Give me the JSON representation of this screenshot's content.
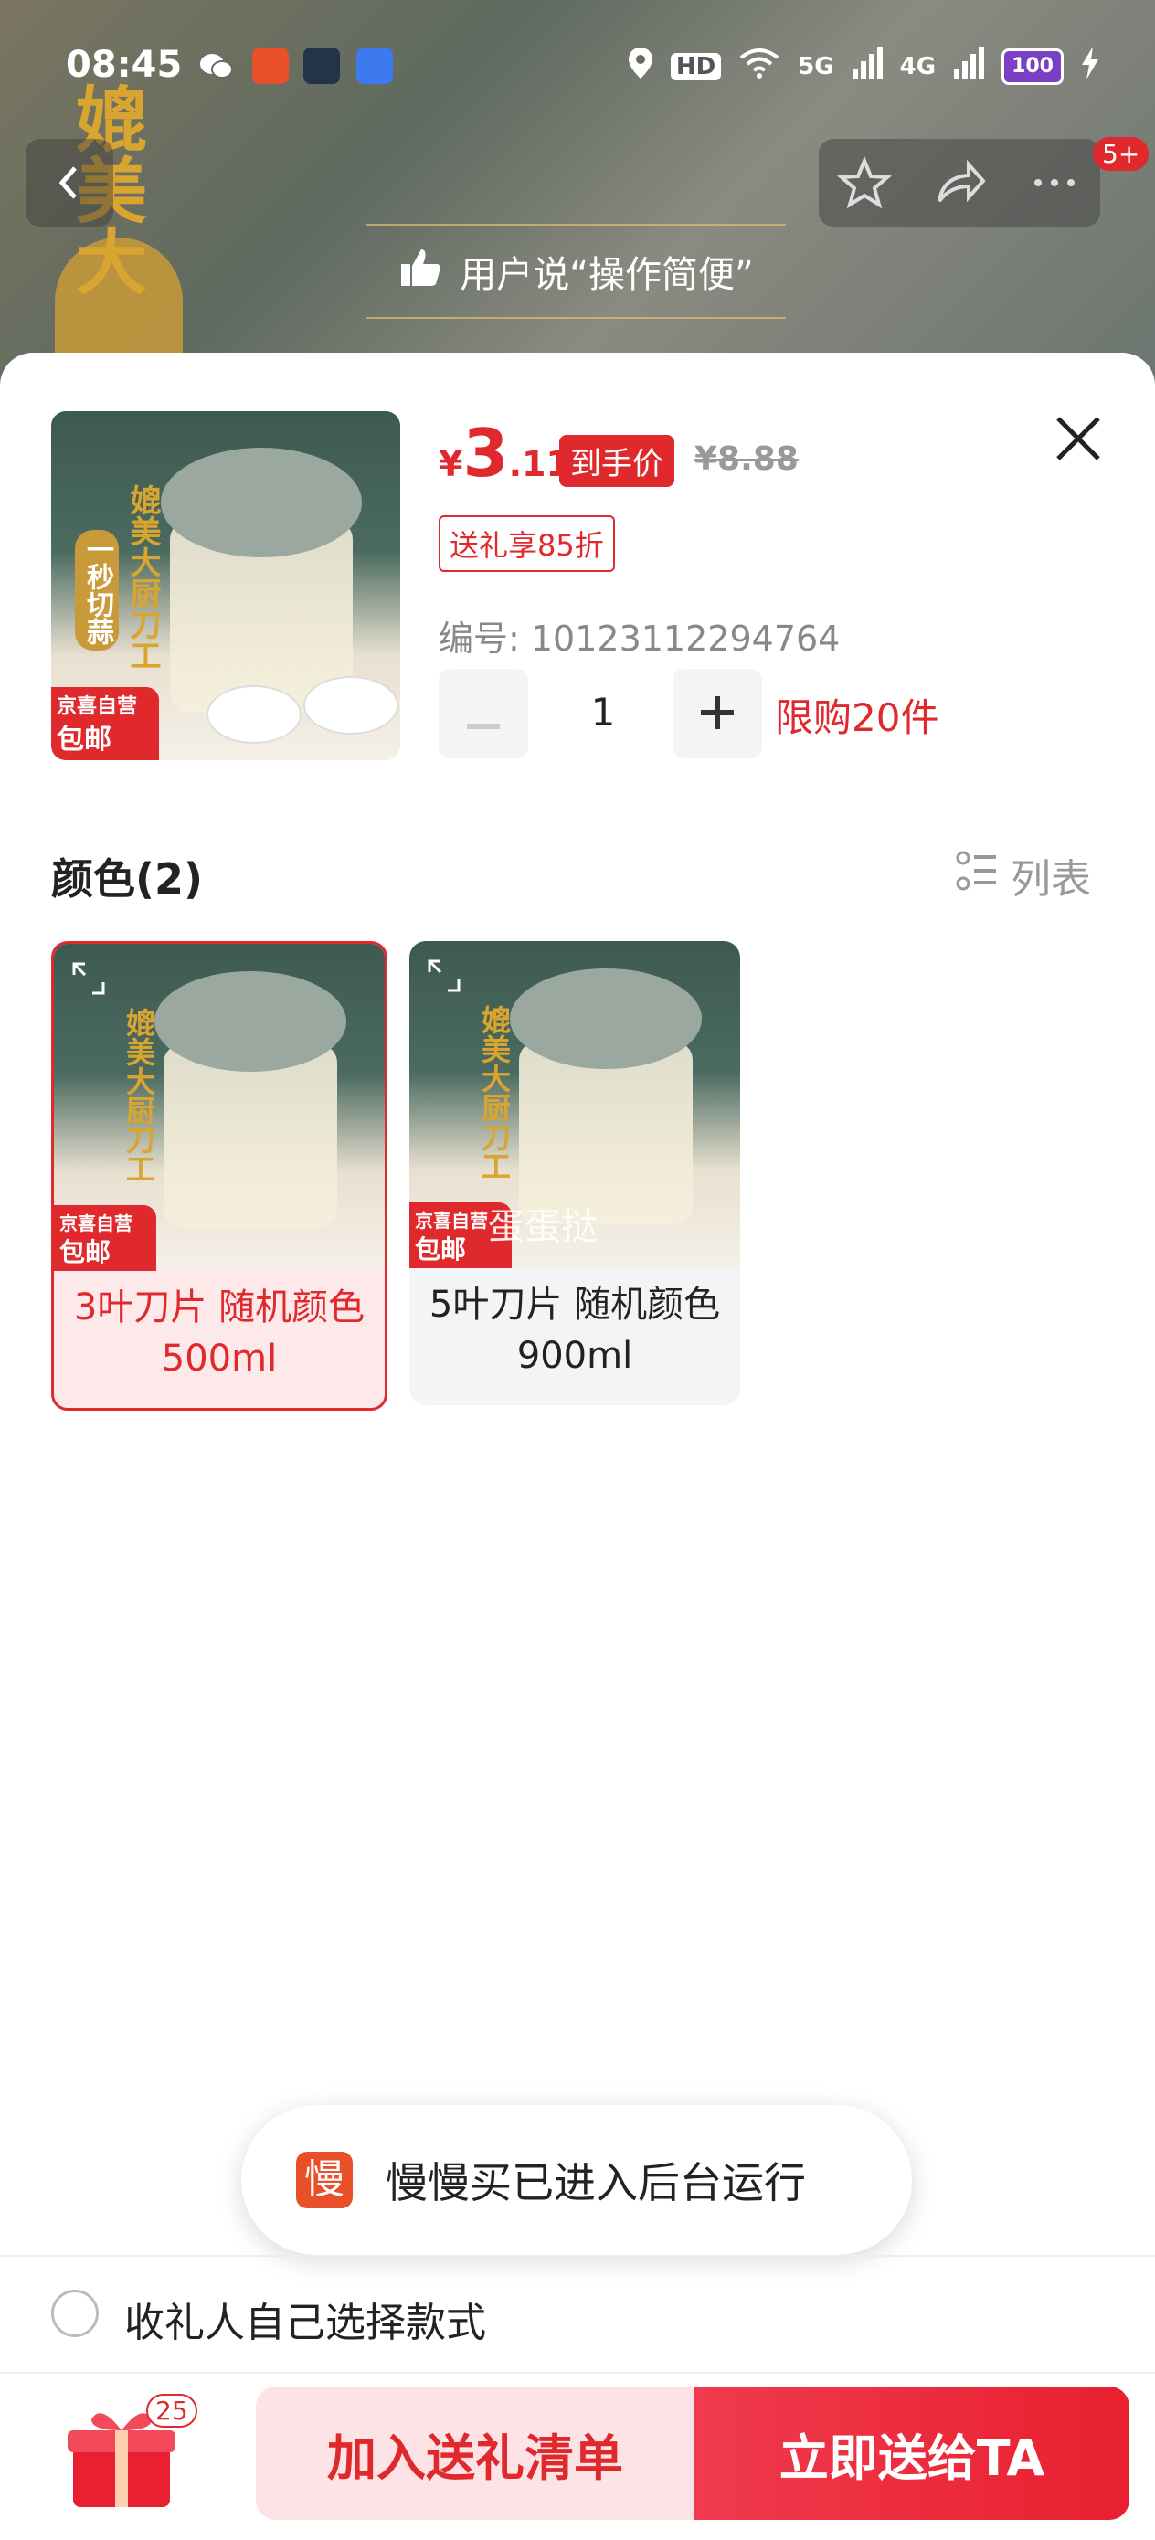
{
  "status_bar": {
    "time": "08:45",
    "hd": "HD",
    "net1": "5G",
    "net2": "4G",
    "battery": "100"
  },
  "banner": {
    "highlight_text": "媲美大",
    "tip": "用户说“操作简便”",
    "badge": "5+"
  },
  "product": {
    "currency": "¥",
    "price_int": "3",
    "price_dec": ".11",
    "price_tag": "到手价",
    "original_price": "¥8.88",
    "discount_tag": "送礼享85折",
    "sku_label": "编号: 10123112294764",
    "quantity": "1",
    "limit": "限购20件",
    "thumb_vertical_1": "媲美大厨刀工",
    "thumb_vertical_2": "一秒切蒜",
    "thumb_tag_top": "京喜自营",
    "thumb_tag_bottom": "包邮"
  },
  "color_section": {
    "title": "颜色(2)",
    "list_label": "列表",
    "options": [
      {
        "label": "3叶刀片 随机颜色 500ml",
        "selected": true
      },
      {
        "label": "5叶刀片 随机颜色 900ml",
        "selected": false
      }
    ],
    "watermark": "蛋蛋挞"
  },
  "toast": {
    "icon_char": "慢",
    "text": "慢慢买已进入后台运行"
  },
  "option_self_select": "收礼人自己选择款式",
  "bottom": {
    "gift_count": "25",
    "add_list": "加入送礼清单",
    "send_now": "立即送给TA"
  },
  "colors": {
    "accent": "#e0292d",
    "toast_icon": "#e9502a"
  }
}
